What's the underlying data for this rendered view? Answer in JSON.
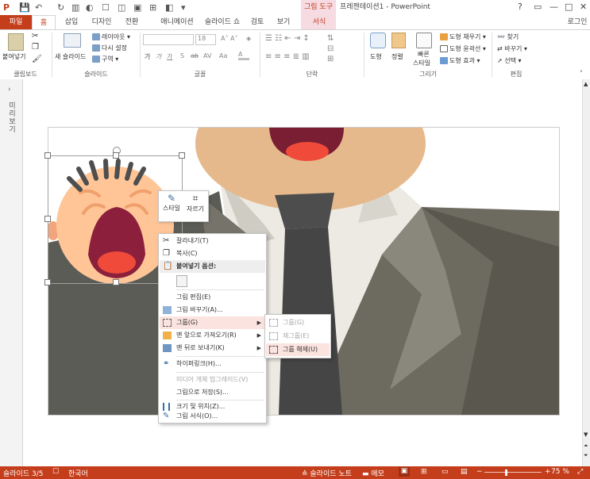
{
  "app": {
    "context_tab_group": "그림 도구",
    "title": "프레젠테이션1 - PowerPoint",
    "window_controls": [
      "?",
      "▭",
      "—",
      "□",
      "✕"
    ],
    "signin": "로그인"
  },
  "tabs": [
    "파일",
    "홈",
    "삽입",
    "디자인",
    "전환",
    "애니메이션",
    "슬라이드 쇼",
    "검토",
    "보기",
    "서식"
  ],
  "ribbon": {
    "clipboard": {
      "paste": "붙여넣기",
      "label": "클립보드"
    },
    "slides": {
      "new_slide": "새 슬라이드",
      "layout": "레이아웃",
      "reset": "다시 설정",
      "section": "구역",
      "label": "슬라이드"
    },
    "font": {
      "size": "18",
      "label": "글꼴",
      "bold": "가",
      "italic": "가",
      "underline": "가",
      "strike": "S",
      "shadow": "ab",
      "spacing": "AV",
      "case": "Aa"
    },
    "paragraph": {
      "label": "단락"
    },
    "drawing": {
      "shape": "도형",
      "arrange": "정렬",
      "quick_style": "빠른",
      "quick_style_2": "스타일",
      "fill": "도형 채우기",
      "outline": "도형 윤곽선",
      "effects": "도형 효과",
      "label": "그리기"
    },
    "editing": {
      "find": "찾기",
      "replace": "바꾸기",
      "select": "선택",
      "label": "편집"
    }
  },
  "left_pane": {
    "label": "미리보기"
  },
  "mini_toolbar": {
    "style": "스타일",
    "crop": "자르기"
  },
  "context_menu": {
    "items": [
      {
        "label": "잘라내기(T)",
        "state": "normal"
      },
      {
        "label": "복사(C)",
        "state": "normal"
      },
      {
        "label": "붙여넣기 옵션:",
        "state": "header"
      },
      {
        "label": "그림 편집(E)",
        "state": "normal"
      },
      {
        "label": "그림 바꾸기(A)...",
        "state": "normal"
      },
      {
        "label": "그룹(G)",
        "state": "highlighted"
      },
      {
        "label": "맨 앞으로 가져오기(R)",
        "state": "normal"
      },
      {
        "label": "맨 뒤로 보내기(K)",
        "state": "normal"
      },
      {
        "label": "하이퍼링크(H)...",
        "state": "normal"
      },
      {
        "label": "미디어 개체 업그레이드(V)",
        "state": "disabled"
      },
      {
        "label": "그림으로 저장(S)...",
        "state": "normal"
      },
      {
        "label": "크기 및 위치(Z)...",
        "state": "normal"
      },
      {
        "label": "그림 서식(O)...",
        "state": "normal"
      }
    ]
  },
  "submenu": {
    "items": [
      {
        "label": "그룹(G)",
        "state": "disabled"
      },
      {
        "label": "재그룹(E)",
        "state": "disabled"
      },
      {
        "label": "그룹 해제(U)",
        "state": "highlighted"
      }
    ]
  },
  "status": {
    "slide": "슬라이드 3/5",
    "language": "한국어",
    "notes": "슬라이드 노트",
    "comments": "메모",
    "zoom": "75 %",
    "zoom_level": 0.75
  },
  "colors": {
    "accent": "#c43e1c",
    "highlight": "#fbe3df",
    "context_tab": "#f6dbe2"
  },
  "icons": [
    "cut-icon",
    "copy-icon",
    "paste-icon",
    "picture-icon",
    "group-icon",
    "bring-front-icon",
    "send-back-icon",
    "hyperlink-icon",
    "size-position-icon",
    "format-picture-icon",
    "style-icon",
    "crop-icon"
  ]
}
